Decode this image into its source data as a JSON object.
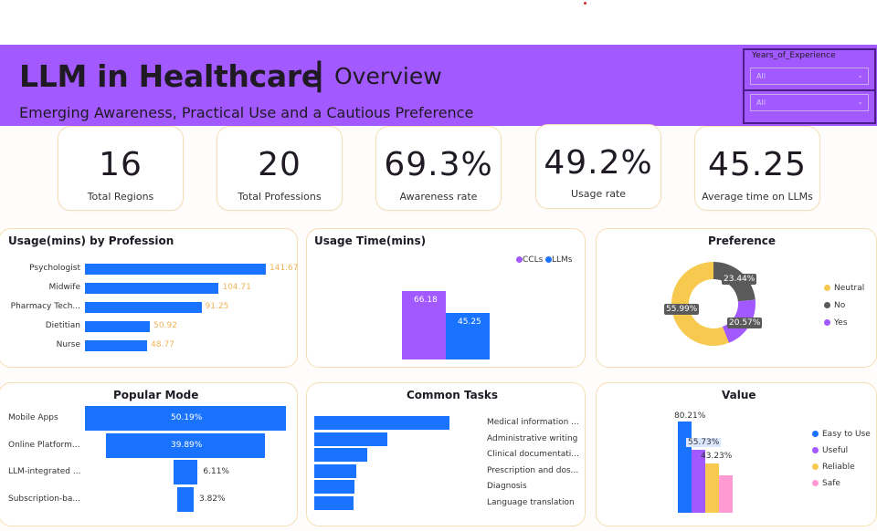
{
  "header": {
    "title": "LLM in Healthcare",
    "separator": "|",
    "subtitle": "Overview",
    "tagline": "Emerging Awareness, Practical Use and a Cautious Preference"
  },
  "slicer": {
    "title": "Years_of_Experience",
    "dropdown1": "All",
    "dropdown2": "All"
  },
  "kpis": [
    {
      "value": "16",
      "label": "Total Regions"
    },
    {
      "value": "20",
      "label": "Total Professions"
    },
    {
      "value": "69.3%",
      "label": "Awareness rate"
    },
    {
      "value": "49.2%",
      "label": "Usage rate"
    },
    {
      "value": "45.25",
      "label": "Average time on LLMs"
    }
  ],
  "colors": {
    "banner": "#a259ff",
    "blue": "#1a73ff",
    "purple": "#a259ff",
    "yellow": "#f7c94f",
    "gray": "#5a5a5a",
    "pink": "#ff9ad5",
    "value_label": "#f0b45a"
  },
  "chart_data": [
    {
      "type": "bar",
      "orientation": "horizontal",
      "title": "Usage(mins) by Profession",
      "categories": [
        "Psychologist",
        "Midwife",
        "Pharmacy Tech...",
        "Dietitian",
        "Nurse"
      ],
      "values": [
        141.67,
        104.71,
        91.25,
        50.92,
        48.77
      ],
      "value_labels": [
        "141.67",
        "104.71",
        "91.25",
        "50.92",
        "48.77"
      ]
    },
    {
      "type": "bar",
      "title": "Usage Time(mins)",
      "series": [
        {
          "name": "CCLs",
          "values": [
            66.18
          ],
          "label": "66.18"
        },
        {
          "name": "LLMs",
          "values": [
            45.25
          ],
          "label": "45.25"
        }
      ],
      "legend": "top-right"
    },
    {
      "type": "pie",
      "title": "Preference",
      "categories": [
        "Neutral",
        "No",
        "Yes"
      ],
      "values": [
        55.99,
        23.44,
        20.57
      ],
      "value_labels": [
        "55.99%",
        "23.44%",
        "20.57%"
      ],
      "legend": "right"
    },
    {
      "type": "bar",
      "orientation": "funnel",
      "title": "Popular Mode",
      "categories": [
        "Mobile Apps",
        "Online Platform...",
        "LLM-integrated ...",
        "Subscription-ba..."
      ],
      "values": [
        50.19,
        39.89,
        6.11,
        3.82
      ],
      "value_labels": [
        "50.19%",
        "39.89%",
        "6.11%",
        "3.82%"
      ]
    },
    {
      "type": "bar",
      "orientation": "horizontal",
      "title": "Common Tasks",
      "categories": [
        "Medical information ...",
        "Administrative writing",
        "Clinical documentati...",
        "Prescription and dos...",
        "Diagnosis",
        "Language translation"
      ],
      "values": [
        100,
        54,
        39,
        31,
        30,
        29
      ]
    },
    {
      "type": "bar",
      "title": "Value",
      "categories": [
        "Easy to Use",
        "Useful",
        "Reliable",
        "Safe"
      ],
      "values": [
        80.21,
        55.73,
        43.23,
        33
      ],
      "value_labels": [
        "80.21%",
        "55.73%",
        "43.23%"
      ],
      "legend": "right"
    }
  ]
}
